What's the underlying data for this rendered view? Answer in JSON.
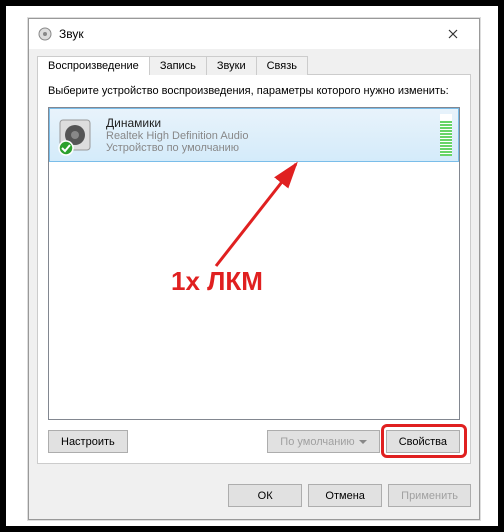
{
  "window": {
    "title": "Звук"
  },
  "tabs": {
    "playback": "Воспроизведение",
    "recording": "Запись",
    "sounds": "Звуки",
    "communications": "Связь"
  },
  "instruction": "Выберите устройство воспроизведения, параметры которого нужно изменить:",
  "device": {
    "name": "Динамики",
    "driver": "Realtek High Definition Audio",
    "status": "Устройство по умолчанию"
  },
  "buttons": {
    "configure": "Настроить",
    "default": "По умолчанию",
    "properties": "Свойства",
    "ok": "ОК",
    "cancel": "Отмена",
    "apply": "Применить"
  },
  "annotation": "1x ЛКМ"
}
